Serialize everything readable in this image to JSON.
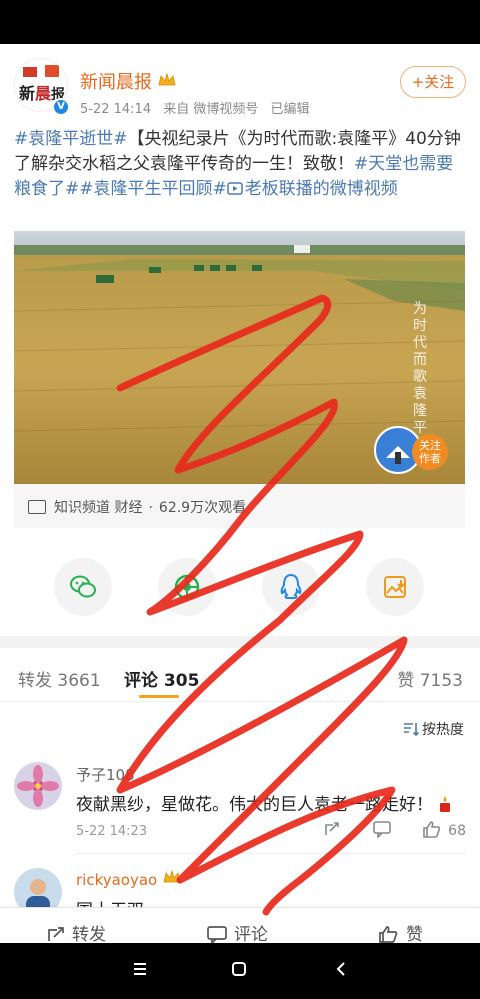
{
  "post": {
    "author": "新闻晨报",
    "date": "5-22 14:14",
    "source": "来自 微博视频号",
    "edited": "已编辑",
    "follow_label": "+关注",
    "text_tag1": "#袁隆平逝世#",
    "text_main": "【央视纪录片《为时代而歌:袁隆平》40分钟了解杂交水稻之父袁隆平传奇的一生！致敬！",
    "text_tag2": "#天堂也需要粮食了#",
    "text_tag3": "#袁隆平生平回顾#",
    "text_tag4": "老板联播的微博视频"
  },
  "video": {
    "badge_label": "关注\n作者",
    "overlay_title": "为时代而歌 袁隆平",
    "channel": "知识频道 财经",
    "dot": "·",
    "views": "62.9万次观看"
  },
  "icons": [
    "wechat-icon",
    "moments-icon",
    "qq-icon",
    "save-image-icon"
  ],
  "tabs": {
    "repost": "转发 3661",
    "comment": "评论 305",
    "like": "赞 7153"
  },
  "sort_label": "按热度",
  "comments": [
    {
      "name": "予子108",
      "text": "夜献黑纱，星做花。伟大的巨人袁老一路走好！",
      "time": "5-22 14:23",
      "likes": "68"
    },
    {
      "name": "rickyaoyao",
      "text": "国士无双"
    }
  ],
  "actions": {
    "repost": "转发",
    "comment": "评论",
    "like": "赞"
  },
  "colors": {
    "accent": "#e66a1b",
    "link": "#4a7ab1",
    "tab_underline": "#f7a21b",
    "scribble": "#e8291c"
  }
}
